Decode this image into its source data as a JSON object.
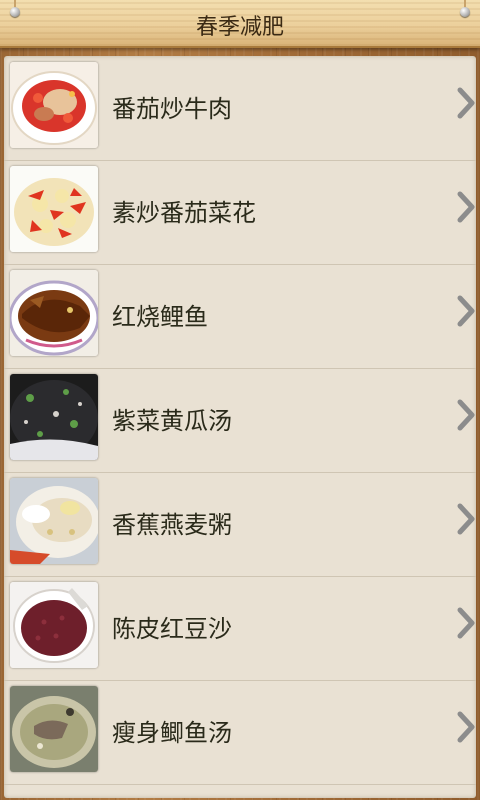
{
  "header": {
    "title": "春季减肥"
  },
  "icons": {
    "row_arrow": "chevron-right-icon"
  },
  "recipes": [
    {
      "label": "番茄炒牛肉",
      "thumb": "tomato-beef"
    },
    {
      "label": "素炒番茄菜花",
      "thumb": "tomato-cauliflower"
    },
    {
      "label": "红烧鲤鱼",
      "thumb": "braised-carp"
    },
    {
      "label": "紫菜黄瓜汤",
      "thumb": "seaweed-soup"
    },
    {
      "label": "香蕉燕麦粥",
      "thumb": "banana-oat-porridge"
    },
    {
      "label": "陈皮红豆沙",
      "thumb": "red-bean-paste"
    },
    {
      "label": "瘦身鲫鱼汤",
      "thumb": "crucian-fish-soup"
    }
  ]
}
